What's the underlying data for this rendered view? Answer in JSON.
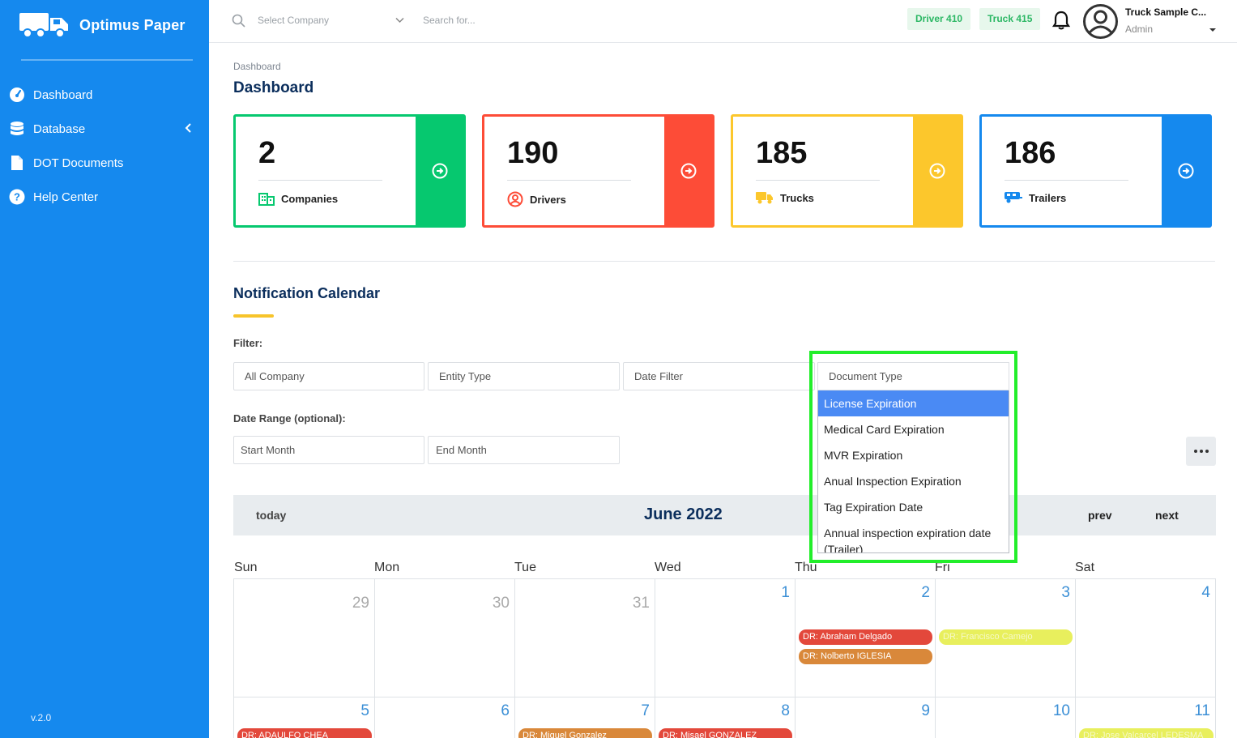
{
  "sidebar": {
    "logo_text": "Optimus Paper",
    "items": [
      {
        "label": "Dashboard",
        "icon": "dashboard-icon"
      },
      {
        "label": "Database",
        "icon": "database-icon"
      },
      {
        "label": "DOT Documents",
        "icon": "document-icon"
      },
      {
        "label": "Help Center",
        "icon": "help-icon"
      }
    ],
    "version": "v.2.0",
    "color": "#1589ee"
  },
  "header": {
    "company_placeholder": "Select Company",
    "search_placeholder": "Search for...",
    "badges": [
      "Driver 410",
      "Truck 415"
    ],
    "user_name": "Truck Sample C...",
    "user_role": "Admin"
  },
  "page": {
    "breadcrumb": "Dashboard",
    "title": "Dashboard"
  },
  "cards": [
    {
      "value": "2",
      "label": "Companies",
      "color": "#06c86f",
      "icon": "building-icon"
    },
    {
      "value": "190",
      "label": "Drivers",
      "color": "#fd4c37",
      "icon": "driver-icon"
    },
    {
      "value": "185",
      "label": "Trucks",
      "color": "#fcc72c",
      "icon": "truck-icon"
    },
    {
      "value": "186",
      "label": "Trailers",
      "color": "#1589ee",
      "icon": "trailer-icon"
    }
  ],
  "notification": {
    "title": "Notification Calendar",
    "filter_label": "Filter:",
    "filters": [
      "All Company",
      "Entity Type",
      "Date Filter"
    ],
    "date_range_label": "Date Range (optional):",
    "start_month": "Start Month",
    "end_month": "End Month"
  },
  "document_type": {
    "placeholder": "Document Type",
    "options": [
      "License Expiration",
      "Medical Card Expiration",
      "MVR Expiration",
      "Anual Inspection Expiration",
      "Tag Expiration Date",
      "Annual inspection expiration date",
      "(Trailer)"
    ],
    "selected": "License Expiration"
  },
  "calendar": {
    "today": "today",
    "month": "June 2022",
    "prev": "prev",
    "next": "next",
    "days": [
      "Sun",
      "Mon",
      "Tue",
      "Wed",
      "Thu",
      "Fri",
      "Sat"
    ],
    "week1": [
      "29",
      "30",
      "31",
      "1",
      "2",
      "3",
      "4"
    ],
    "week2": [
      "5",
      "6",
      "7",
      "8",
      "9",
      "10",
      "11"
    ],
    "events": [
      {
        "text": "DR: Abraham Delgado",
        "color": "#e3483b"
      },
      {
        "text": "DR: Nolberto IGLESIA",
        "color": "#d9883a"
      },
      {
        "text": "DR: Francisco Camejo",
        "color": "#e8ef5d"
      },
      {
        "text": "DR: ADAULFO CHEA",
        "color": "#e3483b"
      },
      {
        "text": "DR: Miguel Gonzalez",
        "color": "#d9883a"
      },
      {
        "text": "DR: Misael GONZALEZ",
        "color": "#e3483b"
      },
      {
        "text": "DR: Jose Valcarcel LEDESMA",
        "color": "#e8ef5d"
      }
    ]
  }
}
